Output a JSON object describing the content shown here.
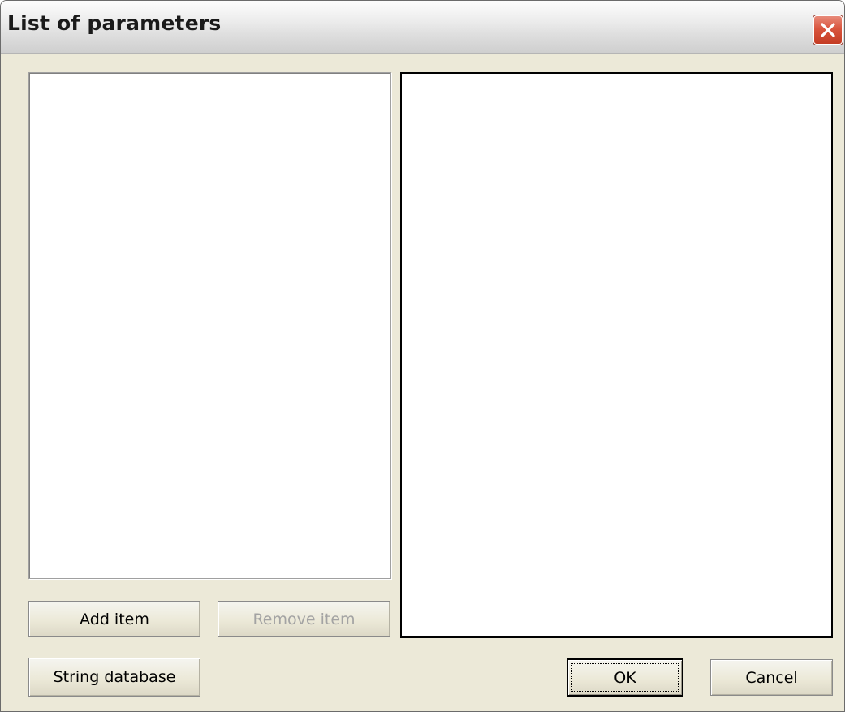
{
  "window": {
    "title": "List of parameters",
    "close_icon": "close-x-icon"
  },
  "left_list": {
    "items": []
  },
  "right_panel": {
    "content": ""
  },
  "buttons": {
    "add_item": "Add item",
    "remove_item": "Remove item",
    "string_database": "String database",
    "ok": "OK",
    "cancel": "Cancel"
  },
  "state": {
    "remove_item_enabled": false,
    "default_button": "ok"
  },
  "colors": {
    "dialog_bg": "#ece9d8",
    "close_button": "#d9553e",
    "disabled_text": "#a3a3a3"
  }
}
